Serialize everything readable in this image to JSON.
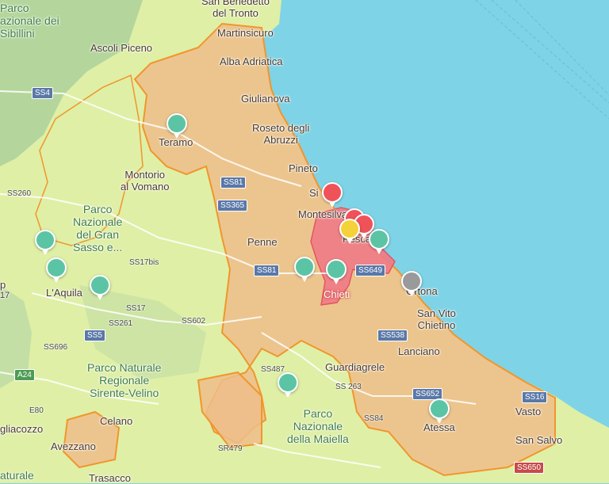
{
  "colors": {
    "sea": "#7fd3e6",
    "land_green": "#d9ec9c",
    "land_mountain": "#b9d7a0",
    "zone_orange": "#eebd8a",
    "zone_border": "#f0962c",
    "zone_red": "#f07a86",
    "marker_green": "#5bc4a4",
    "marker_red": "#f0525a",
    "marker_yellow": "#f5d23c",
    "marker_gray": "#9a9a9a"
  },
  "places": {
    "san_benedetto": "San Benedetto\ndel Tronto",
    "parco_sibillini": "Parco\nazionale dei\nSibillini",
    "martinsicuro": "Martinsicuro",
    "ascoli": "Ascoli Piceno",
    "alba": "Alba Adriatica",
    "giulianova": "Giulianova",
    "roseto": "Roseto degli\nAbruzzi",
    "teramo": "Teramo",
    "montorio": "Montorio\nal Vomano",
    "pineto": "Pineto",
    "silvi": "Si",
    "montesilvano": "Montesilvano",
    "pescara": "Pesca",
    "penne": "Penne",
    "parco_gran_sasso": "Parco\nNazionale\ndel Gran\nSasso e...",
    "aquila": "L'Aquila",
    "chieti": "Chieti",
    "ortona": "Ortona",
    "san_vito": "San Vito\nChietino",
    "lanciano": "Lanciano",
    "guardiagrele": "Guardiagrele",
    "parco_sirente": "Parco Naturale\nRegionale\nSirente-Velino",
    "parco_maiella": "Parco\nNazionale\ndella Maiella",
    "celano": "Celano",
    "avezzano": "Avezzano",
    "atessa": "Atessa",
    "vasto": "Vasto",
    "san_salvo": "San Salvo",
    "tagliacozzo": "gliacozzo",
    "trasacco": "Trasacco",
    "left_edge": "p",
    "left_17": "17",
    "naturale": "aturale"
  },
  "roads": {
    "ss4": "SS4",
    "ss260": "SS260",
    "ss81a": "SS81",
    "ss365": "SS365",
    "ss17bis": "SS17bis",
    "ss17": "SS17",
    "ss81b": "SS81",
    "ss649": "SS649",
    "ss261": "SS261",
    "ss5": "SS5",
    "ss602": "SS602",
    "ss696": "SS696",
    "a24": "A24",
    "ss538": "SS538",
    "ss487": "SS487",
    "ss263": "SS 263",
    "ss652": "SS652",
    "ss16": "SS16",
    "ss584": "SS84",
    "e80": "E80",
    "sr479": "SR479",
    "ss650": "SS650"
  },
  "markers": [
    {
      "id": "teramo",
      "color": "green"
    },
    {
      "id": "gran-sasso-1",
      "color": "green"
    },
    {
      "id": "aquila-1",
      "color": "green"
    },
    {
      "id": "aquila-2",
      "color": "green"
    },
    {
      "id": "penne-east",
      "color": "green"
    },
    {
      "id": "chieti",
      "color": "green"
    },
    {
      "id": "pescara-east",
      "color": "green"
    },
    {
      "id": "silvi",
      "color": "red"
    },
    {
      "id": "pescara-1",
      "color": "red"
    },
    {
      "id": "pescara-2",
      "color": "red"
    },
    {
      "id": "pescara-yellow",
      "color": "yellow"
    },
    {
      "id": "ortona",
      "color": "gray"
    },
    {
      "id": "maiella",
      "color": "green"
    },
    {
      "id": "atessa",
      "color": "green"
    }
  ]
}
